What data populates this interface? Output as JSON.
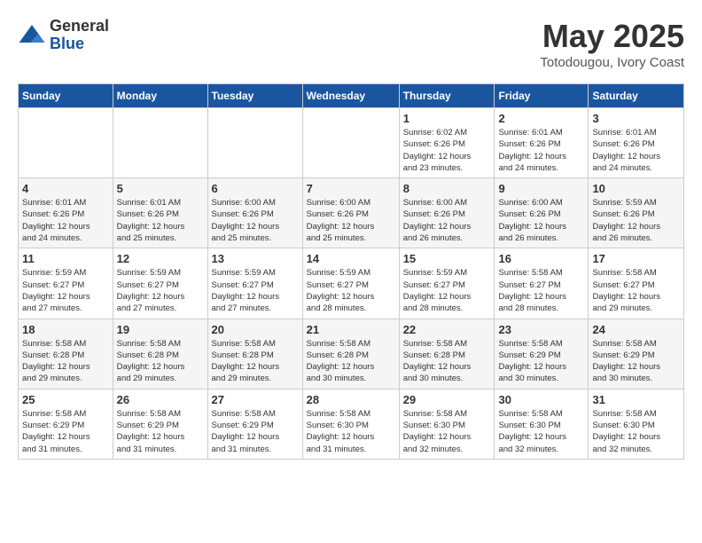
{
  "header": {
    "logo_general": "General",
    "logo_blue": "Blue",
    "month_title": "May 2025",
    "location": "Totodougou, Ivory Coast"
  },
  "days_of_week": [
    "Sunday",
    "Monday",
    "Tuesday",
    "Wednesday",
    "Thursday",
    "Friday",
    "Saturday"
  ],
  "weeks": [
    [
      {
        "day": "",
        "info": ""
      },
      {
        "day": "",
        "info": ""
      },
      {
        "day": "",
        "info": ""
      },
      {
        "day": "",
        "info": ""
      },
      {
        "day": "1",
        "info": "Sunrise: 6:02 AM\nSunset: 6:26 PM\nDaylight: 12 hours\nand 23 minutes."
      },
      {
        "day": "2",
        "info": "Sunrise: 6:01 AM\nSunset: 6:26 PM\nDaylight: 12 hours\nand 24 minutes."
      },
      {
        "day": "3",
        "info": "Sunrise: 6:01 AM\nSunset: 6:26 PM\nDaylight: 12 hours\nand 24 minutes."
      }
    ],
    [
      {
        "day": "4",
        "info": "Sunrise: 6:01 AM\nSunset: 6:26 PM\nDaylight: 12 hours\nand 24 minutes."
      },
      {
        "day": "5",
        "info": "Sunrise: 6:01 AM\nSunset: 6:26 PM\nDaylight: 12 hours\nand 25 minutes."
      },
      {
        "day": "6",
        "info": "Sunrise: 6:00 AM\nSunset: 6:26 PM\nDaylight: 12 hours\nand 25 minutes."
      },
      {
        "day": "7",
        "info": "Sunrise: 6:00 AM\nSunset: 6:26 PM\nDaylight: 12 hours\nand 25 minutes."
      },
      {
        "day": "8",
        "info": "Sunrise: 6:00 AM\nSunset: 6:26 PM\nDaylight: 12 hours\nand 26 minutes."
      },
      {
        "day": "9",
        "info": "Sunrise: 6:00 AM\nSunset: 6:26 PM\nDaylight: 12 hours\nand 26 minutes."
      },
      {
        "day": "10",
        "info": "Sunrise: 5:59 AM\nSunset: 6:26 PM\nDaylight: 12 hours\nand 26 minutes."
      }
    ],
    [
      {
        "day": "11",
        "info": "Sunrise: 5:59 AM\nSunset: 6:27 PM\nDaylight: 12 hours\nand 27 minutes."
      },
      {
        "day": "12",
        "info": "Sunrise: 5:59 AM\nSunset: 6:27 PM\nDaylight: 12 hours\nand 27 minutes."
      },
      {
        "day": "13",
        "info": "Sunrise: 5:59 AM\nSunset: 6:27 PM\nDaylight: 12 hours\nand 27 minutes."
      },
      {
        "day": "14",
        "info": "Sunrise: 5:59 AM\nSunset: 6:27 PM\nDaylight: 12 hours\nand 28 minutes."
      },
      {
        "day": "15",
        "info": "Sunrise: 5:59 AM\nSunset: 6:27 PM\nDaylight: 12 hours\nand 28 minutes."
      },
      {
        "day": "16",
        "info": "Sunrise: 5:58 AM\nSunset: 6:27 PM\nDaylight: 12 hours\nand 28 minutes."
      },
      {
        "day": "17",
        "info": "Sunrise: 5:58 AM\nSunset: 6:27 PM\nDaylight: 12 hours\nand 29 minutes."
      }
    ],
    [
      {
        "day": "18",
        "info": "Sunrise: 5:58 AM\nSunset: 6:28 PM\nDaylight: 12 hours\nand 29 minutes."
      },
      {
        "day": "19",
        "info": "Sunrise: 5:58 AM\nSunset: 6:28 PM\nDaylight: 12 hours\nand 29 minutes."
      },
      {
        "day": "20",
        "info": "Sunrise: 5:58 AM\nSunset: 6:28 PM\nDaylight: 12 hours\nand 29 minutes."
      },
      {
        "day": "21",
        "info": "Sunrise: 5:58 AM\nSunset: 6:28 PM\nDaylight: 12 hours\nand 30 minutes."
      },
      {
        "day": "22",
        "info": "Sunrise: 5:58 AM\nSunset: 6:28 PM\nDaylight: 12 hours\nand 30 minutes."
      },
      {
        "day": "23",
        "info": "Sunrise: 5:58 AM\nSunset: 6:29 PM\nDaylight: 12 hours\nand 30 minutes."
      },
      {
        "day": "24",
        "info": "Sunrise: 5:58 AM\nSunset: 6:29 PM\nDaylight: 12 hours\nand 30 minutes."
      }
    ],
    [
      {
        "day": "25",
        "info": "Sunrise: 5:58 AM\nSunset: 6:29 PM\nDaylight: 12 hours\nand 31 minutes."
      },
      {
        "day": "26",
        "info": "Sunrise: 5:58 AM\nSunset: 6:29 PM\nDaylight: 12 hours\nand 31 minutes."
      },
      {
        "day": "27",
        "info": "Sunrise: 5:58 AM\nSunset: 6:29 PM\nDaylight: 12 hours\nand 31 minutes."
      },
      {
        "day": "28",
        "info": "Sunrise: 5:58 AM\nSunset: 6:30 PM\nDaylight: 12 hours\nand 31 minutes."
      },
      {
        "day": "29",
        "info": "Sunrise: 5:58 AM\nSunset: 6:30 PM\nDaylight: 12 hours\nand 32 minutes."
      },
      {
        "day": "30",
        "info": "Sunrise: 5:58 AM\nSunset: 6:30 PM\nDaylight: 12 hours\nand 32 minutes."
      },
      {
        "day": "31",
        "info": "Sunrise: 5:58 AM\nSunset: 6:30 PM\nDaylight: 12 hours\nand 32 minutes."
      }
    ]
  ]
}
